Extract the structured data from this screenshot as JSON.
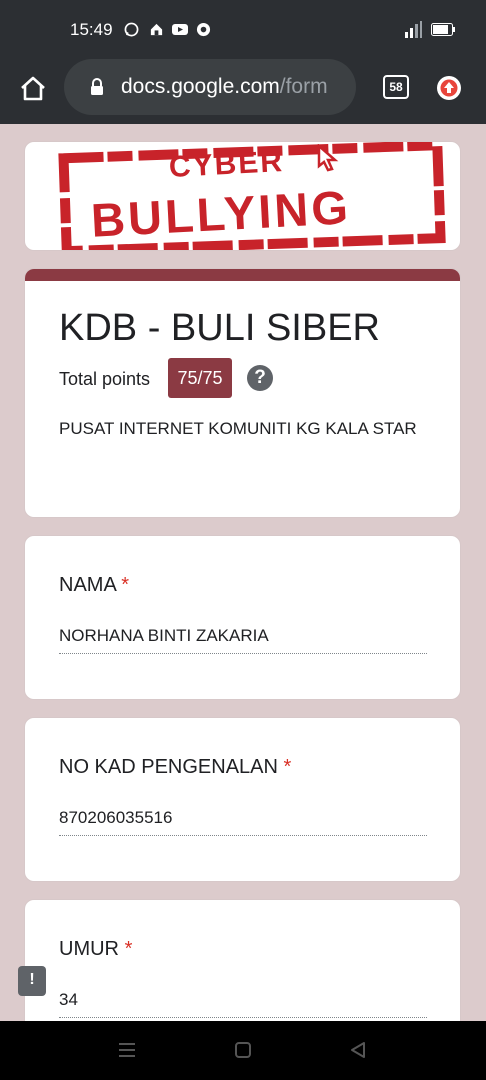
{
  "status": {
    "time": "15:49",
    "battery": "76"
  },
  "browser": {
    "url_main": "docs.google.com",
    "url_rest": "/form",
    "tab_count": "58"
  },
  "banner": {
    "line1": "CYBER",
    "line2": "BULLYING"
  },
  "form": {
    "title": "KDB - BULI SIBER",
    "points_label": "Total points",
    "points_value": "75/75",
    "help_symbol": "?",
    "description": "PUSAT INTERNET KOMUNITI KG KALA STAR",
    "accent_color": "#8b3a43",
    "background_color": "#dccbcc"
  },
  "questions": [
    {
      "label": "NAMA",
      "required_mark": "*",
      "answer": "NORHANA BINTI ZAKARIA"
    },
    {
      "label": "NO KAD PENGENALAN",
      "required_mark": "*",
      "answer": "870206035516"
    },
    {
      "label": "UMUR",
      "required_mark": "*",
      "answer": "34"
    }
  ],
  "report": {
    "symbol": "!"
  }
}
